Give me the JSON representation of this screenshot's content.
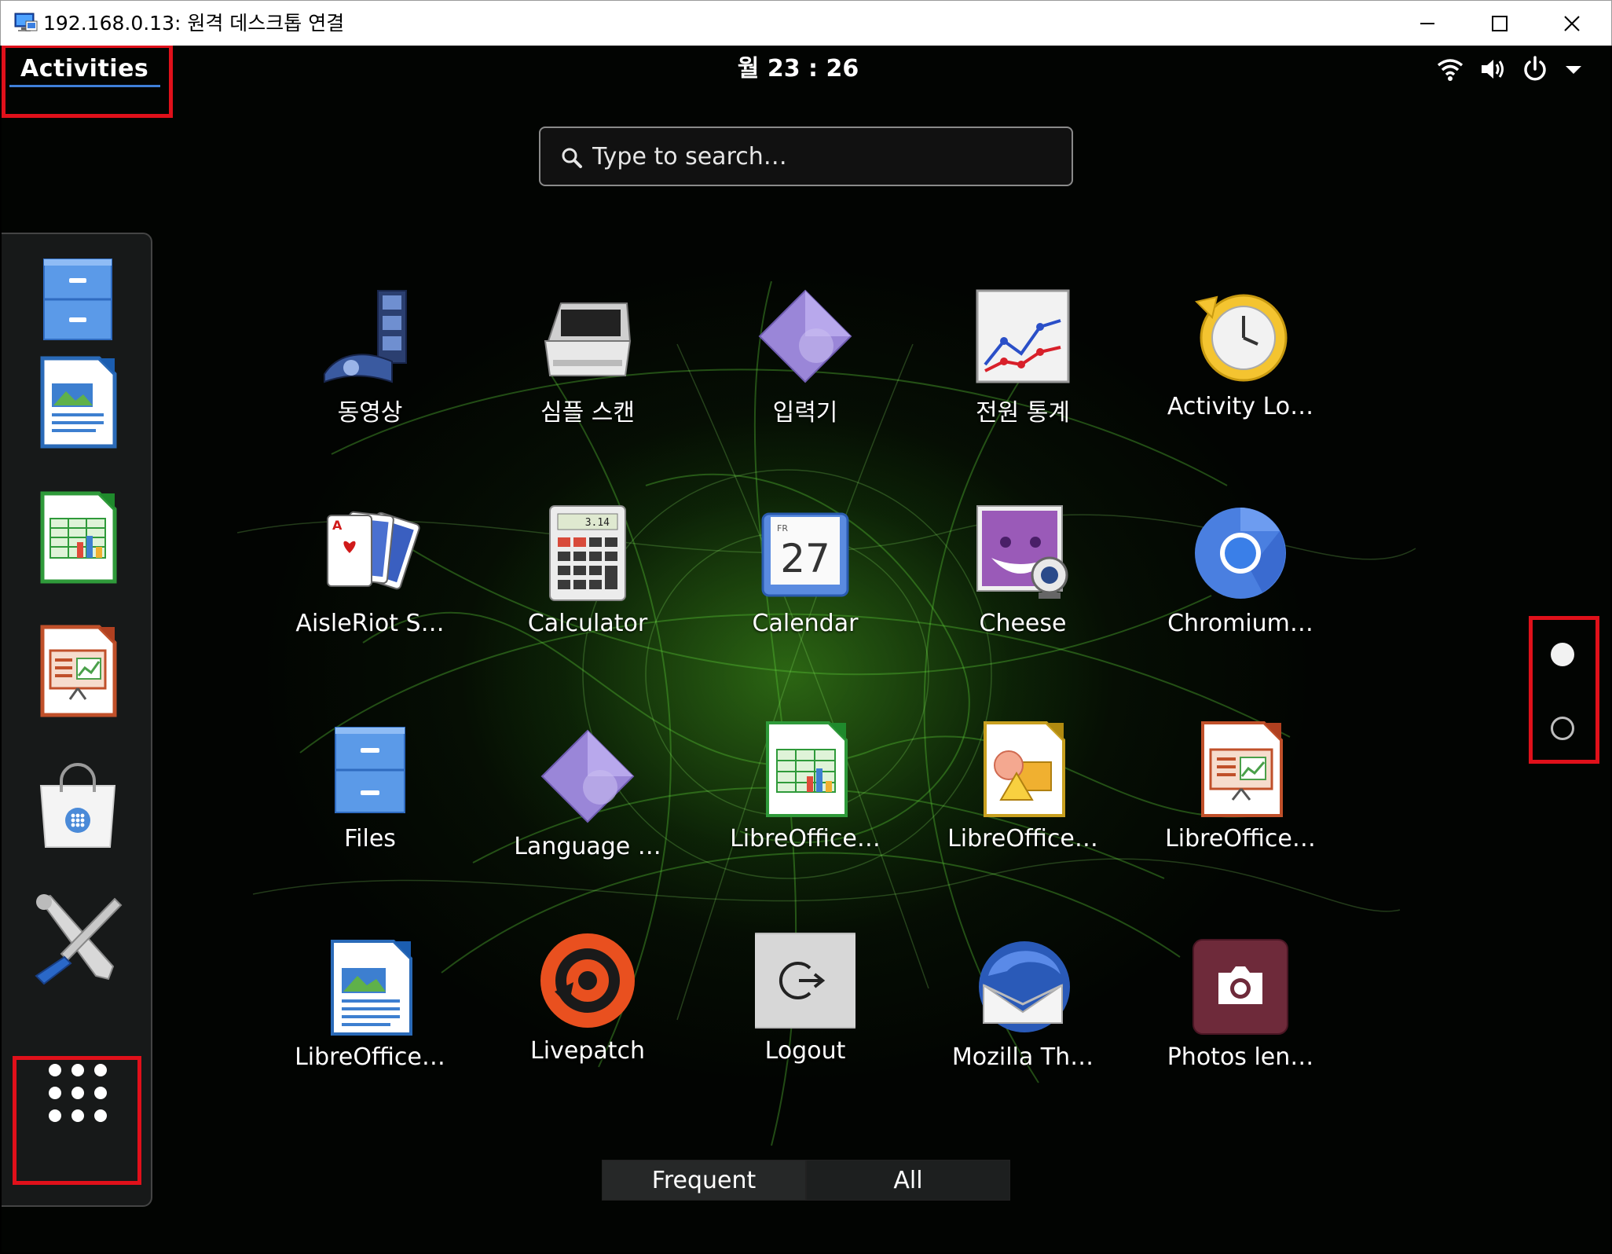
{
  "window": {
    "title": "192.168.0.13: 원격 데스크톱 연결",
    "controls": [
      "minimize-icon",
      "maximize-icon",
      "close-icon"
    ]
  },
  "topbar": {
    "activities_label": "Activities",
    "clock": "월 23 : 26",
    "status_icons": [
      "wifi-icon",
      "volume-icon",
      "power-icon",
      "chevron-down-icon"
    ]
  },
  "search": {
    "placeholder": "Type to search…",
    "value": ""
  },
  "dash": {
    "items": [
      {
        "name": "files",
        "icon": "file-cabinet-icon"
      },
      {
        "name": "libreoffice-writer",
        "icon": "writer-document-icon"
      },
      {
        "name": "libreoffice-calc",
        "icon": "calc-spreadsheet-icon"
      },
      {
        "name": "libreoffice-impress",
        "icon": "impress-presentation-icon"
      },
      {
        "name": "software",
        "icon": "shopping-bag-icon"
      },
      {
        "name": "settings",
        "icon": "wrench-screwdriver-icon"
      },
      {
        "name": "show-applications",
        "icon": "app-grid-icon"
      }
    ]
  },
  "apps": [
    {
      "label": "동영상",
      "icon": "film-reel-icon"
    },
    {
      "label": "심플 스캔",
      "icon": "scanner-icon"
    },
    {
      "label": "입력기",
      "icon": "input-method-icon"
    },
    {
      "label": "전원 통계",
      "icon": "power-statistics-icon"
    },
    {
      "label": "Activity Lo…",
      "icon": "activity-log-icon"
    },
    {
      "label": "AisleRiot S…",
      "icon": "playing-cards-icon"
    },
    {
      "label": "Calculator",
      "icon": "calculator-icon"
    },
    {
      "label": "Calendar",
      "icon": "calendar-icon"
    },
    {
      "label": "Cheese",
      "icon": "cheese-webcam-icon"
    },
    {
      "label": "Chromium…",
      "icon": "chromium-icon"
    },
    {
      "label": "Files",
      "icon": "file-cabinet-icon"
    },
    {
      "label": "Language …",
      "icon": "language-support-icon"
    },
    {
      "label": "LibreOffice…",
      "icon": "calc-spreadsheet-icon"
    },
    {
      "label": "LibreOffice…",
      "icon": "draw-shapes-icon"
    },
    {
      "label": "LibreOffice…",
      "icon": "impress-presentation-icon"
    },
    {
      "label": "LibreOffice…",
      "icon": "writer-document-icon"
    },
    {
      "label": "Livepatch",
      "icon": "livepatch-icon"
    },
    {
      "label": "Logout",
      "icon": "logout-icon"
    },
    {
      "label": "Mozilla Th…",
      "icon": "thunderbird-icon"
    },
    {
      "label": "Photos len…",
      "icon": "camera-icon"
    }
  ],
  "calendar_icon": {
    "month": "FR",
    "day": "27"
  },
  "calculator_display": "3.14",
  "pager": {
    "pages": 2,
    "current": 1
  },
  "tabs": [
    {
      "label": "Frequent",
      "active": false
    },
    {
      "label": "All",
      "active": true
    }
  ],
  "colors": {
    "highlight": "#e0101a",
    "activities_underline": "#3f7fd8"
  }
}
